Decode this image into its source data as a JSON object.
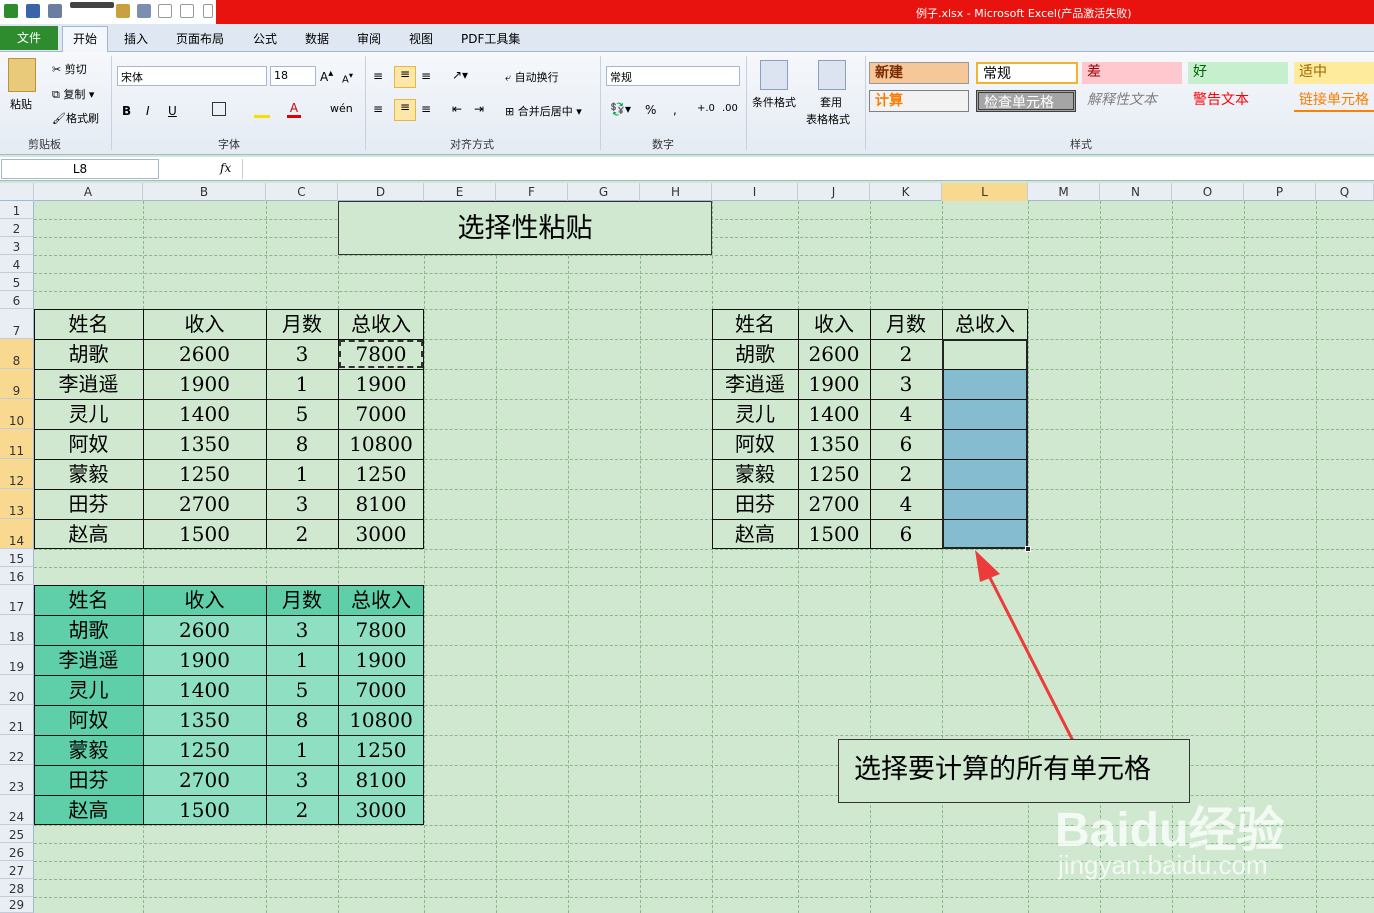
{
  "title_bar": {
    "title": "例子.xlsx - Microsoft Excel(产品激活失败)"
  },
  "tabs": [
    "文件",
    "开始",
    "插入",
    "页面布局",
    "公式",
    "数据",
    "审阅",
    "视图",
    "PDF工具集"
  ],
  "ribbon": {
    "clipboard": {
      "paste": "粘贴",
      "cut": "剪切",
      "copy": "复制",
      "format_painter": "格式刷",
      "label": "剪贴板"
    },
    "font": {
      "name": "宋体",
      "size": "18",
      "label": "字体"
    },
    "alignment": {
      "wrap": "自动换行",
      "merge": "合并后居中",
      "label": "对齐方式"
    },
    "number": {
      "format": "常规",
      "label": "数字"
    },
    "cond": {
      "cond_format": "条件格式",
      "table_format_1": "套用",
      "table_format_2": "表格格式"
    },
    "styles": {
      "label": "样式",
      "items": [
        "新建",
        "常规",
        "差",
        "好",
        "适中",
        "计算",
        "检查单元格",
        "解释性文本",
        "警告文本",
        "链接单元格"
      ]
    }
  },
  "formula_bar": {
    "name_box": "L8",
    "fx": "fx"
  },
  "columns": [
    "A",
    "B",
    "C",
    "D",
    "E",
    "F",
    "G",
    "H",
    "I",
    "J",
    "K",
    "L",
    "M",
    "N",
    "O",
    "P",
    "Q"
  ],
  "rows": [
    "1",
    "2",
    "3",
    "4",
    "5",
    "6",
    "7",
    "8",
    "9",
    "10",
    "11",
    "12",
    "13",
    "14",
    "15",
    "16",
    "17",
    "18",
    "19",
    "20",
    "21",
    "22",
    "23",
    "24",
    "25",
    "26",
    "27",
    "28",
    "29"
  ],
  "sheet": {
    "title": "选择性粘贴",
    "headers": [
      "姓名",
      "收入",
      "月数",
      "总收入"
    ],
    "table1": [
      [
        "胡歌",
        "2600",
        "3",
        "7800"
      ],
      [
        "李逍遥",
        "1900",
        "1",
        "1900"
      ],
      [
        "灵儿",
        "1400",
        "5",
        "7000"
      ],
      [
        "阿奴",
        "1350",
        "8",
        "10800"
      ],
      [
        "蒙毅",
        "1250",
        "1",
        "1250"
      ],
      [
        "田芬",
        "2700",
        "3",
        "8100"
      ],
      [
        "赵高",
        "1500",
        "2",
        "3000"
      ]
    ],
    "table2": [
      [
        "胡歌",
        "2600",
        "3",
        "7800"
      ],
      [
        "李逍遥",
        "1900",
        "1",
        "1900"
      ],
      [
        "灵儿",
        "1400",
        "5",
        "7000"
      ],
      [
        "阿奴",
        "1350",
        "8",
        "10800"
      ],
      [
        "蒙毅",
        "1250",
        "1",
        "1250"
      ],
      [
        "田芬",
        "2700",
        "3",
        "8100"
      ],
      [
        "赵高",
        "1500",
        "2",
        "3000"
      ]
    ],
    "table3": [
      [
        "胡歌",
        "2600",
        "2",
        ""
      ],
      [
        "李逍遥",
        "1900",
        "3",
        ""
      ],
      [
        "灵儿",
        "1400",
        "4",
        ""
      ],
      [
        "阿奴",
        "1350",
        "6",
        ""
      ],
      [
        "蒙毅",
        "1250",
        "2",
        ""
      ],
      [
        "田芬",
        "2700",
        "4",
        ""
      ],
      [
        "赵高",
        "1500",
        "6",
        ""
      ]
    ]
  },
  "annotation": {
    "text": "选择要计算的所有单元格"
  },
  "watermark": {
    "text1": "Baidu经验",
    "text2": "jingyan.baidu.com"
  },
  "colors": {
    "title_red": "#e8130f",
    "file_tab": "#2e8b2e",
    "sheet_bg": "#cfe8cf",
    "table2_header": "#5ecfa9",
    "table2_body": "#8fe0c2",
    "selection": "#86bcd0",
    "arrow": "#ec3b3b"
  }
}
